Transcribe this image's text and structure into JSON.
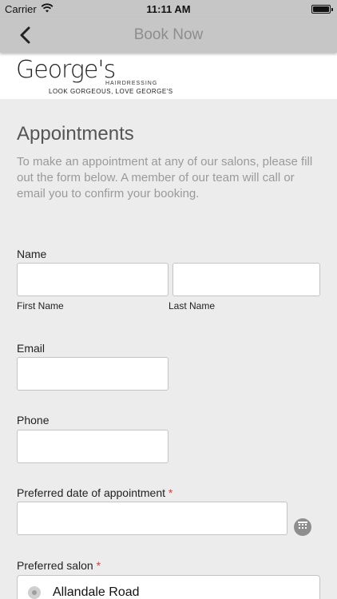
{
  "status_bar": {
    "carrier": "Carrier",
    "time": "11:11 AM"
  },
  "nav": {
    "title": "Book Now",
    "back_icon": "chevron-left-icon"
  },
  "brand": {
    "logo": "George's",
    "sub": "HAIRDRESSING",
    "tagline": "LOOK GORGEOUS, LOVE GEORGE'S"
  },
  "page": {
    "heading": "Appointments",
    "intro": "To make an appointment at any of our salons, please fill out the form below. A member of our team will call or email you to confirm your booking."
  },
  "form": {
    "name": {
      "label": "Name",
      "first_label": "First Name",
      "last_label": "Last Name",
      "first_value": "",
      "last_value": ""
    },
    "email": {
      "label": "Email",
      "value": ""
    },
    "phone": {
      "label": "Phone",
      "value": ""
    },
    "date": {
      "label": "Preferred date of appointment",
      "required_mark": "*",
      "value": ""
    },
    "salon": {
      "label": "Preferred salon",
      "required_mark": "*",
      "options": [
        "Allandale Road"
      ]
    }
  },
  "colors": {
    "bar_bg": "#c6c6c6",
    "page_bg": "#ececec",
    "required": "#e53935"
  }
}
